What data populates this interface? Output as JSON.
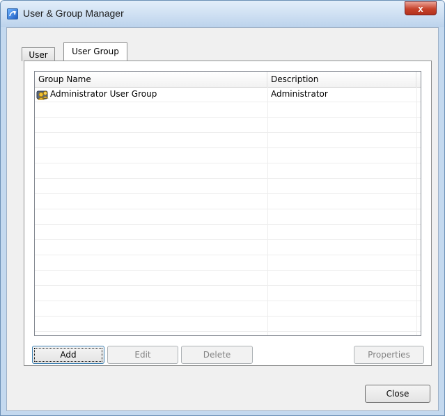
{
  "window": {
    "title": "User & Group Manager",
    "close_glyph": "x"
  },
  "tabs": [
    {
      "label": "User"
    },
    {
      "label": "User Group"
    }
  ],
  "list": {
    "columns": [
      "Group Name",
      "Description"
    ],
    "rows": [
      {
        "name": "Administrator User Group",
        "description": "Administrator",
        "icon": "user-group-icon"
      }
    ]
  },
  "buttons": {
    "add": "Add",
    "edit": "Edit",
    "delete": "Delete",
    "properties": "Properties",
    "close": "Close"
  },
  "colors": {
    "title_bar": "#bcd3ec",
    "close_button": "#c6422b",
    "dialog_bg": "#f0f0f0"
  }
}
